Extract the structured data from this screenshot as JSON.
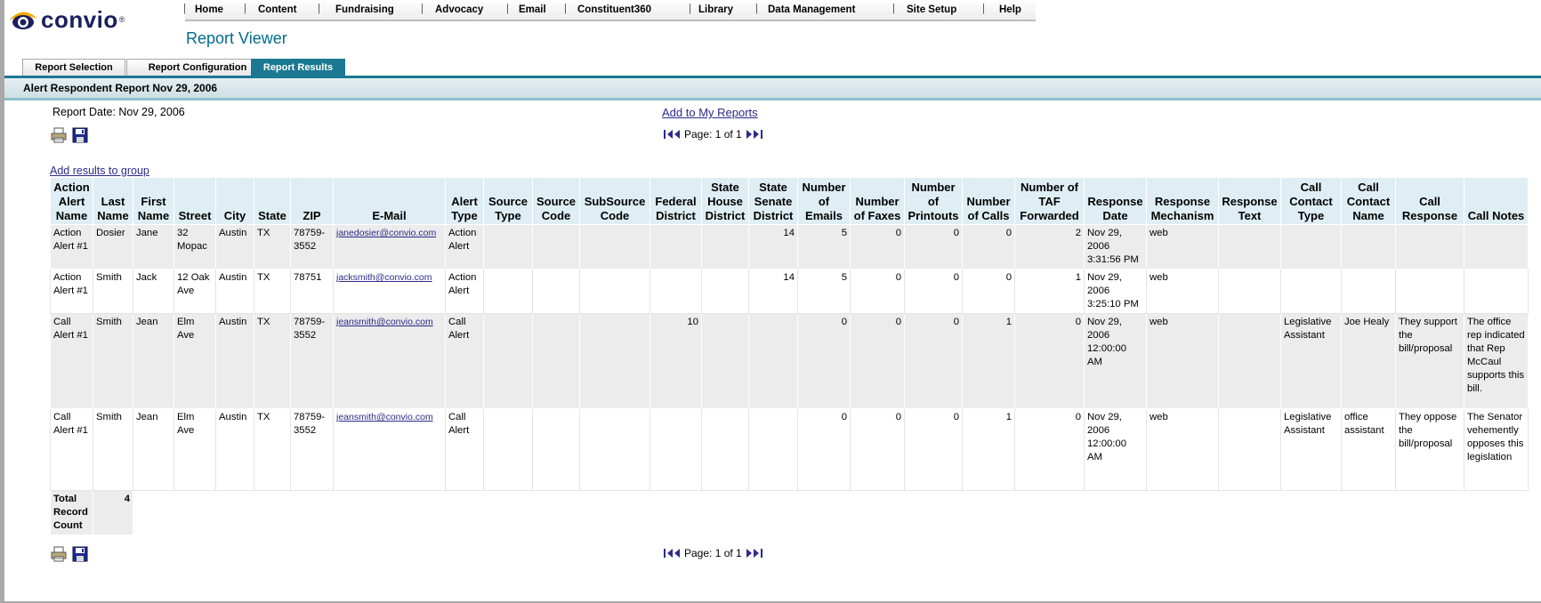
{
  "app": {
    "logo_text": "convio",
    "logo_reg": "®"
  },
  "nav": {
    "items": [
      "Home",
      "Content",
      "Fundraising",
      "Advocacy",
      "Email",
      "Constituent360",
      "Library",
      "Data Management",
      "Site Setup",
      "Help"
    ],
    "separator": "|"
  },
  "page_title": "Report Viewer",
  "tabs": [
    {
      "label": "Report Selection",
      "active": false
    },
    {
      "label": "Report Configuration",
      "active": false
    },
    {
      "label": "Report Results",
      "active": true
    }
  ],
  "report": {
    "title": "Alert Respondent Report Nov 29, 2006",
    "date_label": "Report Date:",
    "date_value": "Nov 29, 2006",
    "add_to_reports": "Add to My Reports",
    "add_results_group": "Add results to group",
    "pager_text": "Page: 1 of 1",
    "print_icon": "printer-icon",
    "save_icon": "floppy-disk-icon"
  },
  "table": {
    "headers": [
      "Action Alert Name",
      "Last Name",
      "First Name",
      "Street",
      "City",
      "State",
      "ZIP",
      "E-Mail",
      "Alert Type",
      "Source Type",
      "Source Code",
      "SubSource Code",
      "Federal District",
      "State House District",
      "State Senate District",
      "Number of Emails",
      "Number of Faxes",
      "Number of Printouts",
      "Number of Calls",
      "Number of TAF Forwarded",
      "Response Date",
      "Response Mechanism",
      "Response Text",
      "Call Contact Type",
      "Call Contact Name",
      "Call Response",
      "Call Notes"
    ],
    "rows": [
      [
        "Action Alert #1",
        "Dosier",
        "Jane",
        "32 Mopac",
        "Austin",
        "TX",
        "78759-3552",
        "janedosier@convio.com",
        "Action Alert",
        "",
        "",
        "",
        "",
        "",
        "14",
        "5",
        "0",
        "0",
        "0",
        "2",
        "Nov 29, 2006 3:31:56 PM",
        "web",
        "",
        "",
        "",
        "",
        ""
      ],
      [
        "Action Alert #1",
        "Smith",
        "Jack",
        "12 Oak Ave",
        "Austin",
        "TX",
        "78751",
        "jacksmith@convio.com",
        "Action Alert",
        "",
        "",
        "",
        "",
        "",
        "14",
        "5",
        "0",
        "0",
        "0",
        "1",
        "Nov 29, 2006 3:25:10 PM",
        "web",
        "",
        "",
        "",
        "",
        ""
      ],
      [
        "Call Alert #1",
        "Smith",
        "Jean",
        "Elm Ave",
        "Austin",
        "TX",
        "78759-3552",
        "jeansmith@convio.com",
        "Call Alert",
        "",
        "",
        "",
        "10",
        "",
        "",
        "0",
        "0",
        "0",
        "1",
        "0",
        "Nov 29, 2006 12:00:00 AM",
        "web",
        "",
        "Legislative Assistant",
        "Joe Healy",
        "They support the bill/proposal",
        "The office rep indicated that Rep McCaul supports this bill."
      ],
      [
        "Call Alert #1",
        "Smith",
        "Jean",
        "Elm Ave",
        "Austin",
        "TX",
        "78759-3552",
        "jeansmith@convio.com",
        "Call Alert",
        "",
        "",
        "",
        "",
        "",
        "",
        "0",
        "0",
        "0",
        "1",
        "0",
        "Nov 29, 2006 12:00:00 AM",
        "web",
        "",
        "Legislative Assistant",
        "office assistant",
        "They oppose the bill/proposal",
        "The Senator vehemently opposes this legislation"
      ]
    ],
    "total_label": "Total Record Count",
    "total_value": "4"
  }
}
